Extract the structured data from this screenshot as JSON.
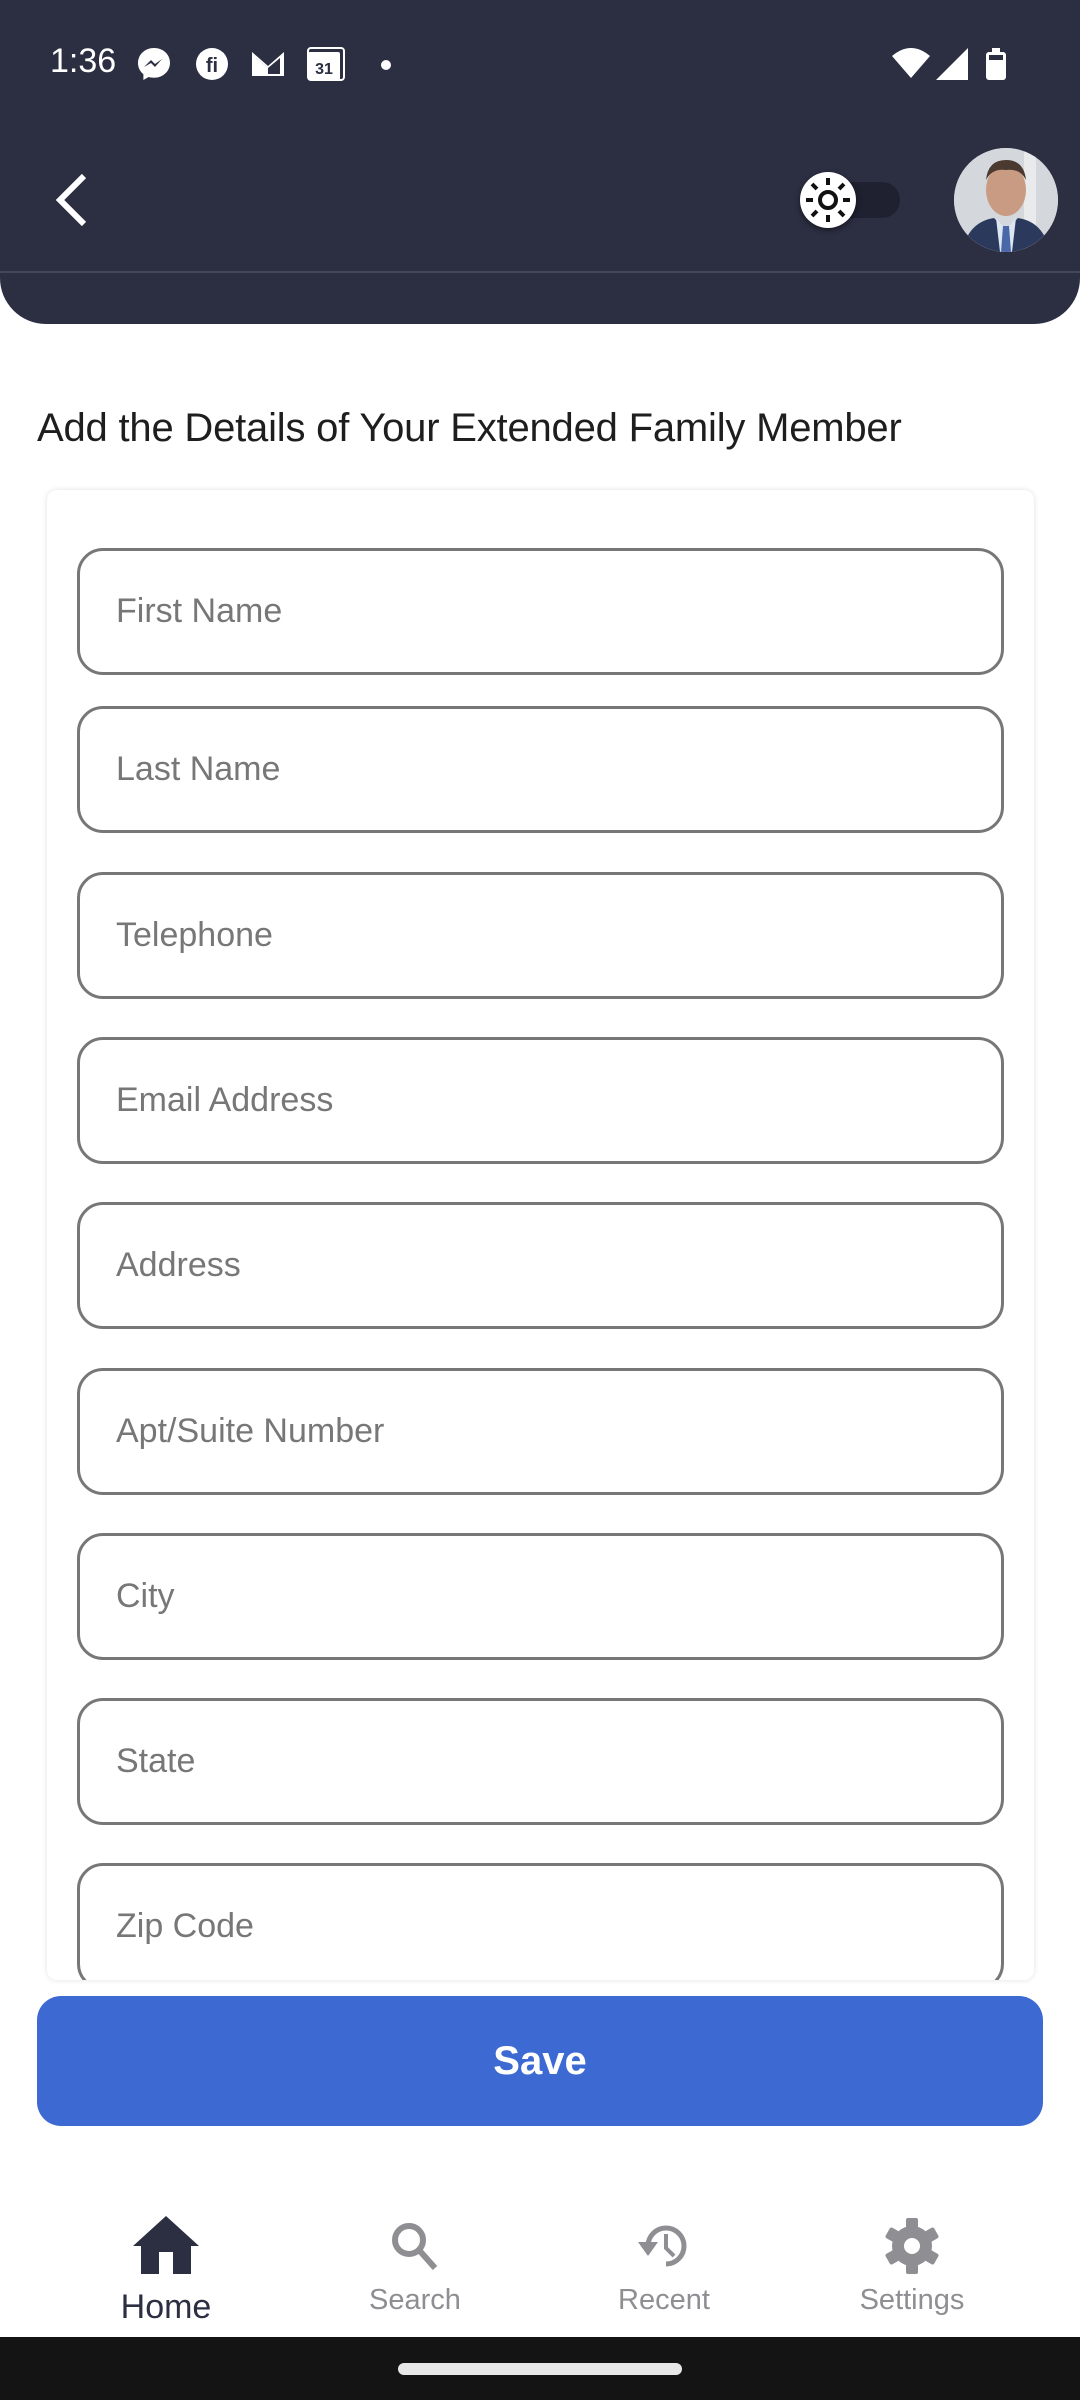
{
  "status_bar": {
    "time": "1:36",
    "notification_icons": [
      "messenger-icon",
      "fi-icon",
      "gmail-icon",
      "calendar-icon",
      "dot-icon"
    ],
    "calendar_day": "31",
    "system_icons": [
      "wifi-icon",
      "signal-icon",
      "battery-icon"
    ]
  },
  "header": {
    "back_icon": "chevron-left-icon",
    "theme_toggle": {
      "icon": "sun-icon",
      "state": "off"
    },
    "avatar": "user-avatar",
    "bg_color": "#2c2e42"
  },
  "page": {
    "title": "Add the Details of Your Extended Family Member"
  },
  "form": {
    "fields": [
      {
        "name": "first-name",
        "placeholder": "First Name",
        "value": ""
      },
      {
        "name": "last-name",
        "placeholder": "Last Name",
        "value": ""
      },
      {
        "name": "telephone",
        "placeholder": "Telephone",
        "value": ""
      },
      {
        "name": "email-address",
        "placeholder": "Email Address",
        "value": ""
      },
      {
        "name": "address",
        "placeholder": "Address",
        "value": ""
      },
      {
        "name": "apt-suite-number",
        "placeholder": "Apt/Suite Number",
        "value": ""
      },
      {
        "name": "city",
        "placeholder": "City",
        "value": ""
      },
      {
        "name": "state",
        "placeholder": "State",
        "value": ""
      },
      {
        "name": "zip-code",
        "placeholder": "Zip Code",
        "value": ""
      }
    ],
    "save_label": "Save",
    "accent_color": "#3d6ad2"
  },
  "bottom_nav": {
    "items": [
      {
        "label": "Home",
        "icon": "home-icon",
        "active": true
      },
      {
        "label": "Search",
        "icon": "search-icon",
        "active": false
      },
      {
        "label": "Recent",
        "icon": "history-icon",
        "active": false
      },
      {
        "label": "Settings",
        "icon": "gear-icon",
        "active": false
      }
    ]
  }
}
